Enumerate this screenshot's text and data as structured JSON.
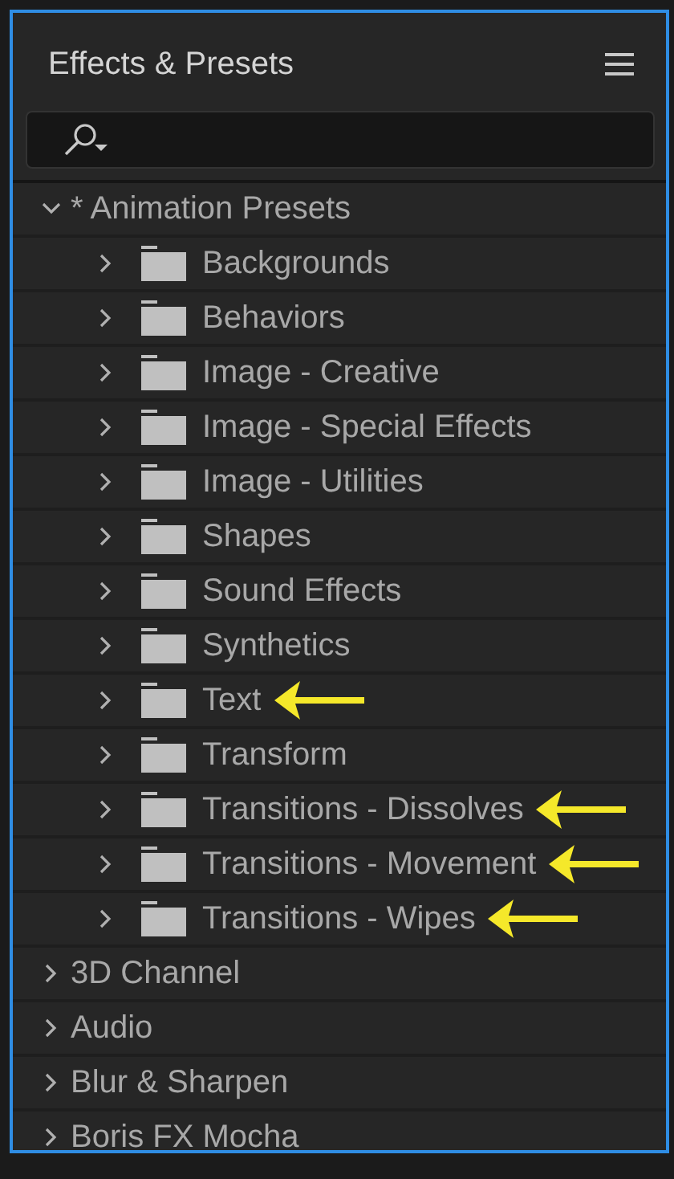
{
  "panel": {
    "title": "Effects & Presets"
  },
  "tree": [
    {
      "label": "* Animation Presets",
      "expanded": true,
      "children": [
        {
          "label": "Backgrounds",
          "marked": false
        },
        {
          "label": "Behaviors",
          "marked": false
        },
        {
          "label": "Image - Creative",
          "marked": false
        },
        {
          "label": "Image - Special Effects",
          "marked": false
        },
        {
          "label": "Image - Utilities",
          "marked": false
        },
        {
          "label": "Shapes",
          "marked": false
        },
        {
          "label": "Sound Effects",
          "marked": false
        },
        {
          "label": "Synthetics",
          "marked": false
        },
        {
          "label": "Text",
          "marked": true
        },
        {
          "label": "Transform",
          "marked": false
        },
        {
          "label": "Transitions - Dissolves",
          "marked": true
        },
        {
          "label": "Transitions - Movement",
          "marked": true
        },
        {
          "label": "Transitions - Wipes",
          "marked": true
        }
      ]
    },
    {
      "label": "3D Channel",
      "expanded": false
    },
    {
      "label": "Audio",
      "expanded": false
    },
    {
      "label": "Blur & Sharpen",
      "expanded": false
    },
    {
      "label": "Boris FX Mocha",
      "expanded": false
    }
  ]
}
